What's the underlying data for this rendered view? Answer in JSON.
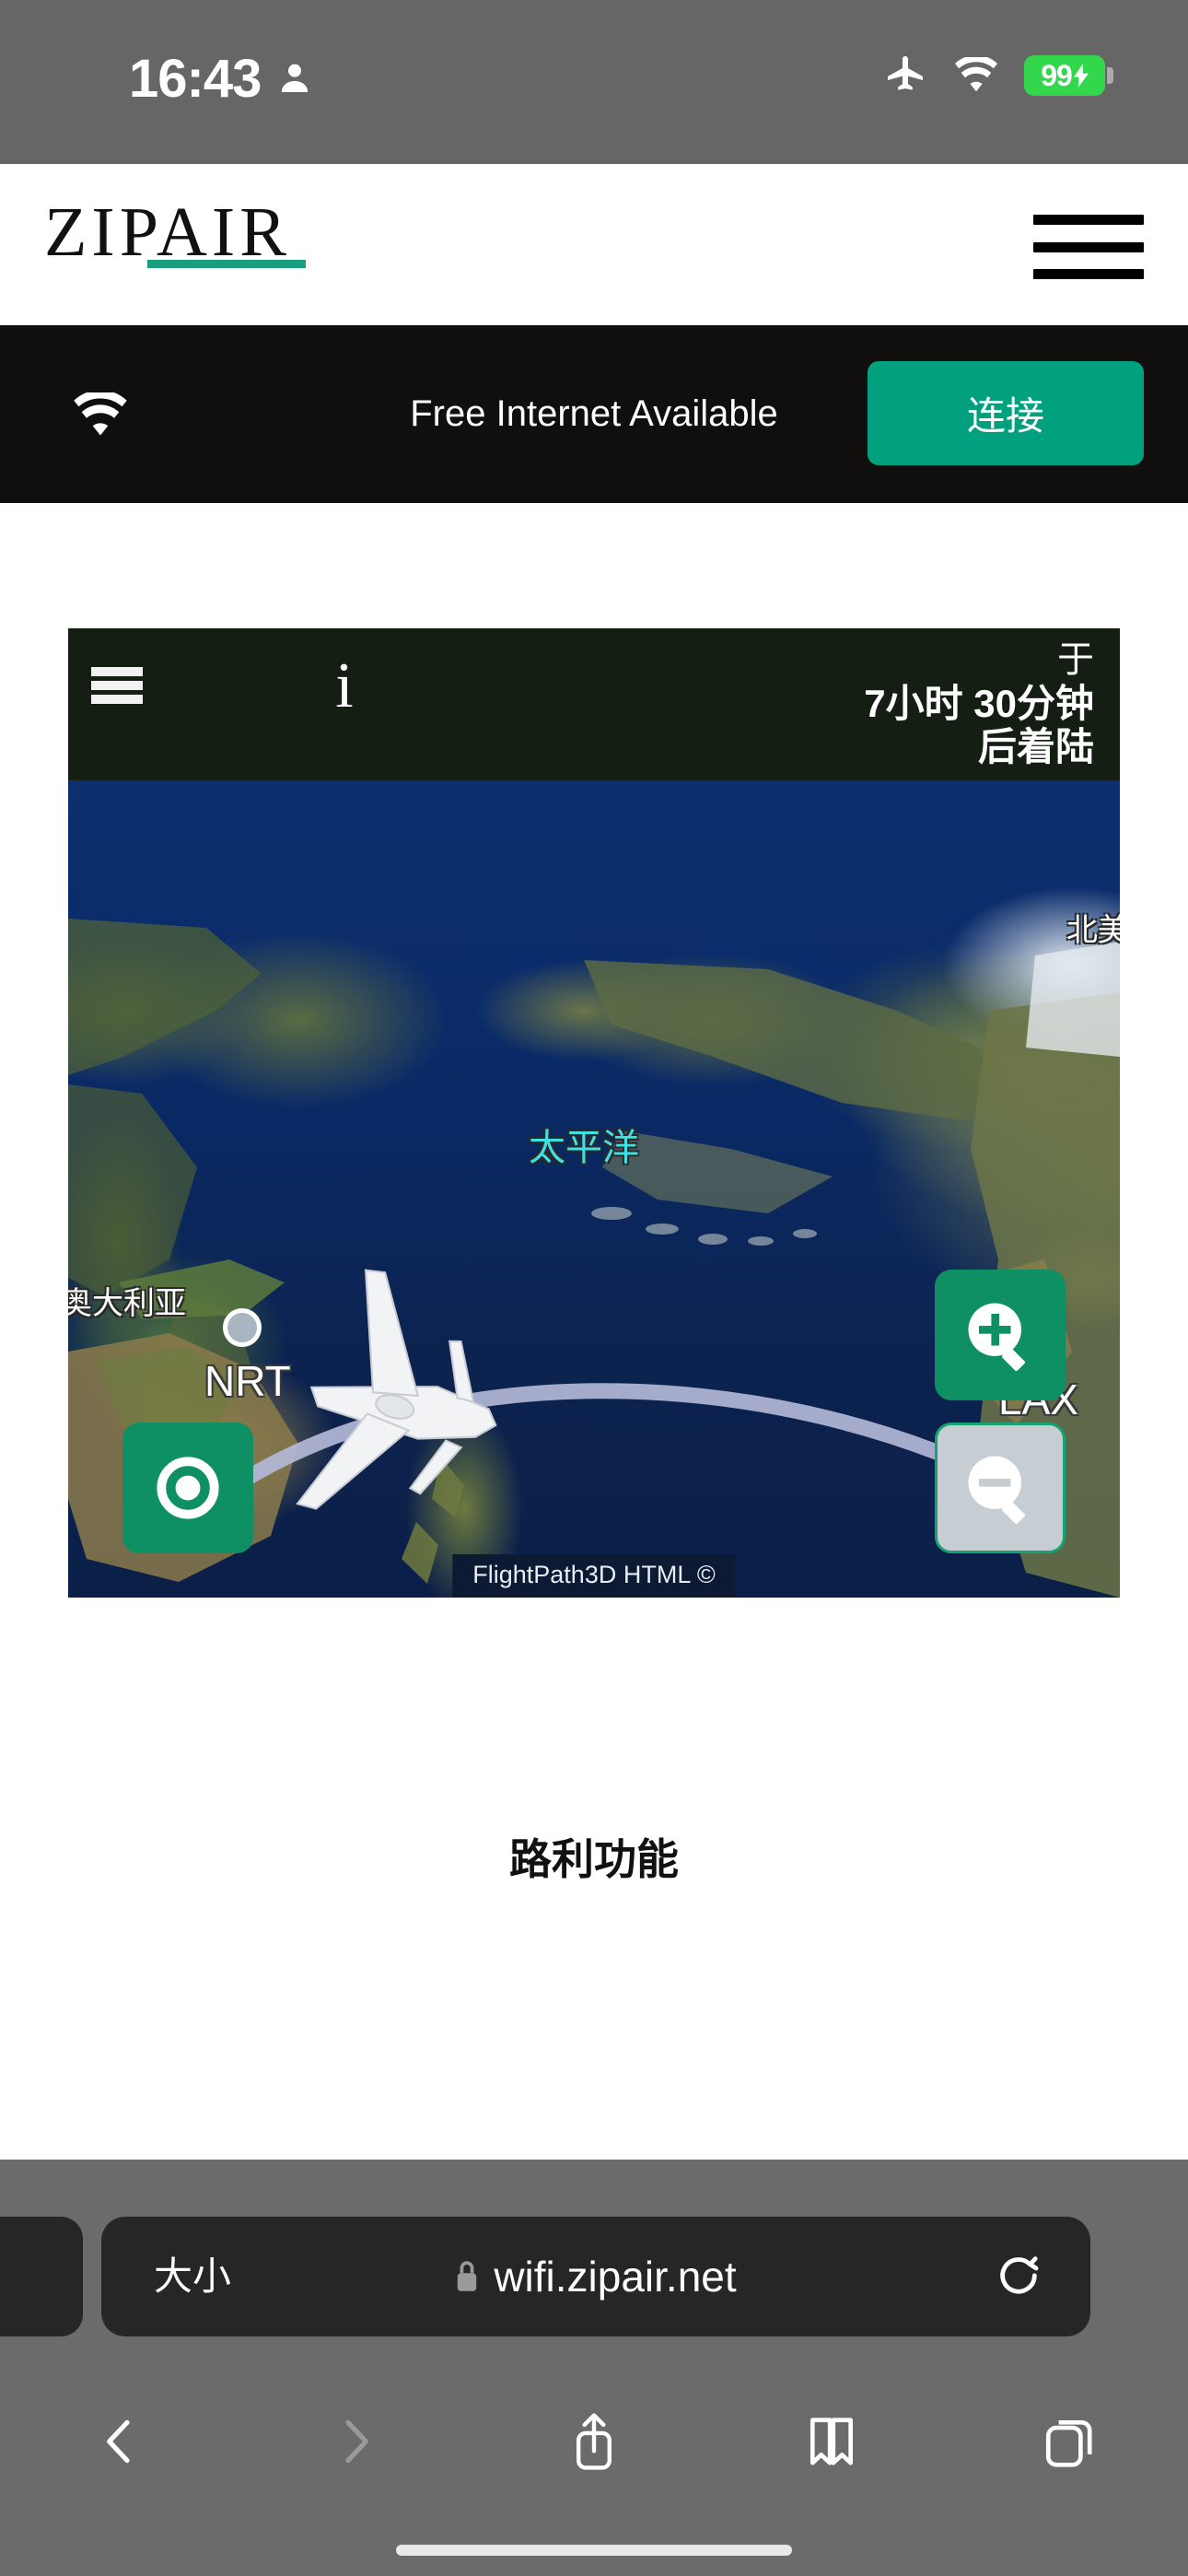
{
  "status_bar": {
    "time": "16:43",
    "person_icon": "person-icon",
    "airplane_icon": "airplane-mode-icon",
    "wifi_icon": "wifi-icon",
    "battery_percent": "99",
    "battery_charging": true,
    "battery_color": "#32d74b"
  },
  "site_header": {
    "logo_text": "ZIPAIR",
    "logo_accent_color": "#1b9e7f",
    "menu_icon": "hamburger-menu-icon"
  },
  "wifi_banner": {
    "icon": "wifi-icon",
    "message": "Free Internet Available",
    "connect_label": "连接",
    "button_color": "#01a07e",
    "background_color": "#100f0e"
  },
  "map_widget": {
    "topbar": {
      "menu_icon": "hamburger-menu-icon",
      "info_icon": "i",
      "eta_line1": "于",
      "eta_line2": "7小时 30分钟",
      "eta_line3": "后着陆"
    },
    "origin": {
      "code": "NRT",
      "marker_color": "#a9b6c2"
    },
    "destination": {
      "code": "LAX",
      "marker_color": "#0d9668"
    },
    "map_labels": [
      {
        "text": "北美",
        "type": "region"
      },
      {
        "text": "太平洋",
        "type": "ocean",
        "color": "#3fe0e8"
      },
      {
        "text": "奥大利亚",
        "type": "region"
      }
    ],
    "controls": {
      "center_label": "center-map",
      "zoom_in_label": "zoom-in",
      "zoom_out_label": "zoom-out",
      "zoom_out_disabled": true
    },
    "attribution": "FlightPath3D HTML ©"
  },
  "page_content": {
    "below_map_text": "路利功能"
  },
  "browser": {
    "size_button": "大小",
    "url": "wifi.zipair.net",
    "lock_icon": "lock-icon",
    "reload_icon": "reload-icon",
    "toolbar": {
      "back": "back-icon",
      "back_enabled": true,
      "forward": "forward-icon",
      "forward_enabled": false,
      "share": "share-icon",
      "bookmarks": "bookmarks-icon",
      "tabs": "tabs-icon"
    }
  }
}
